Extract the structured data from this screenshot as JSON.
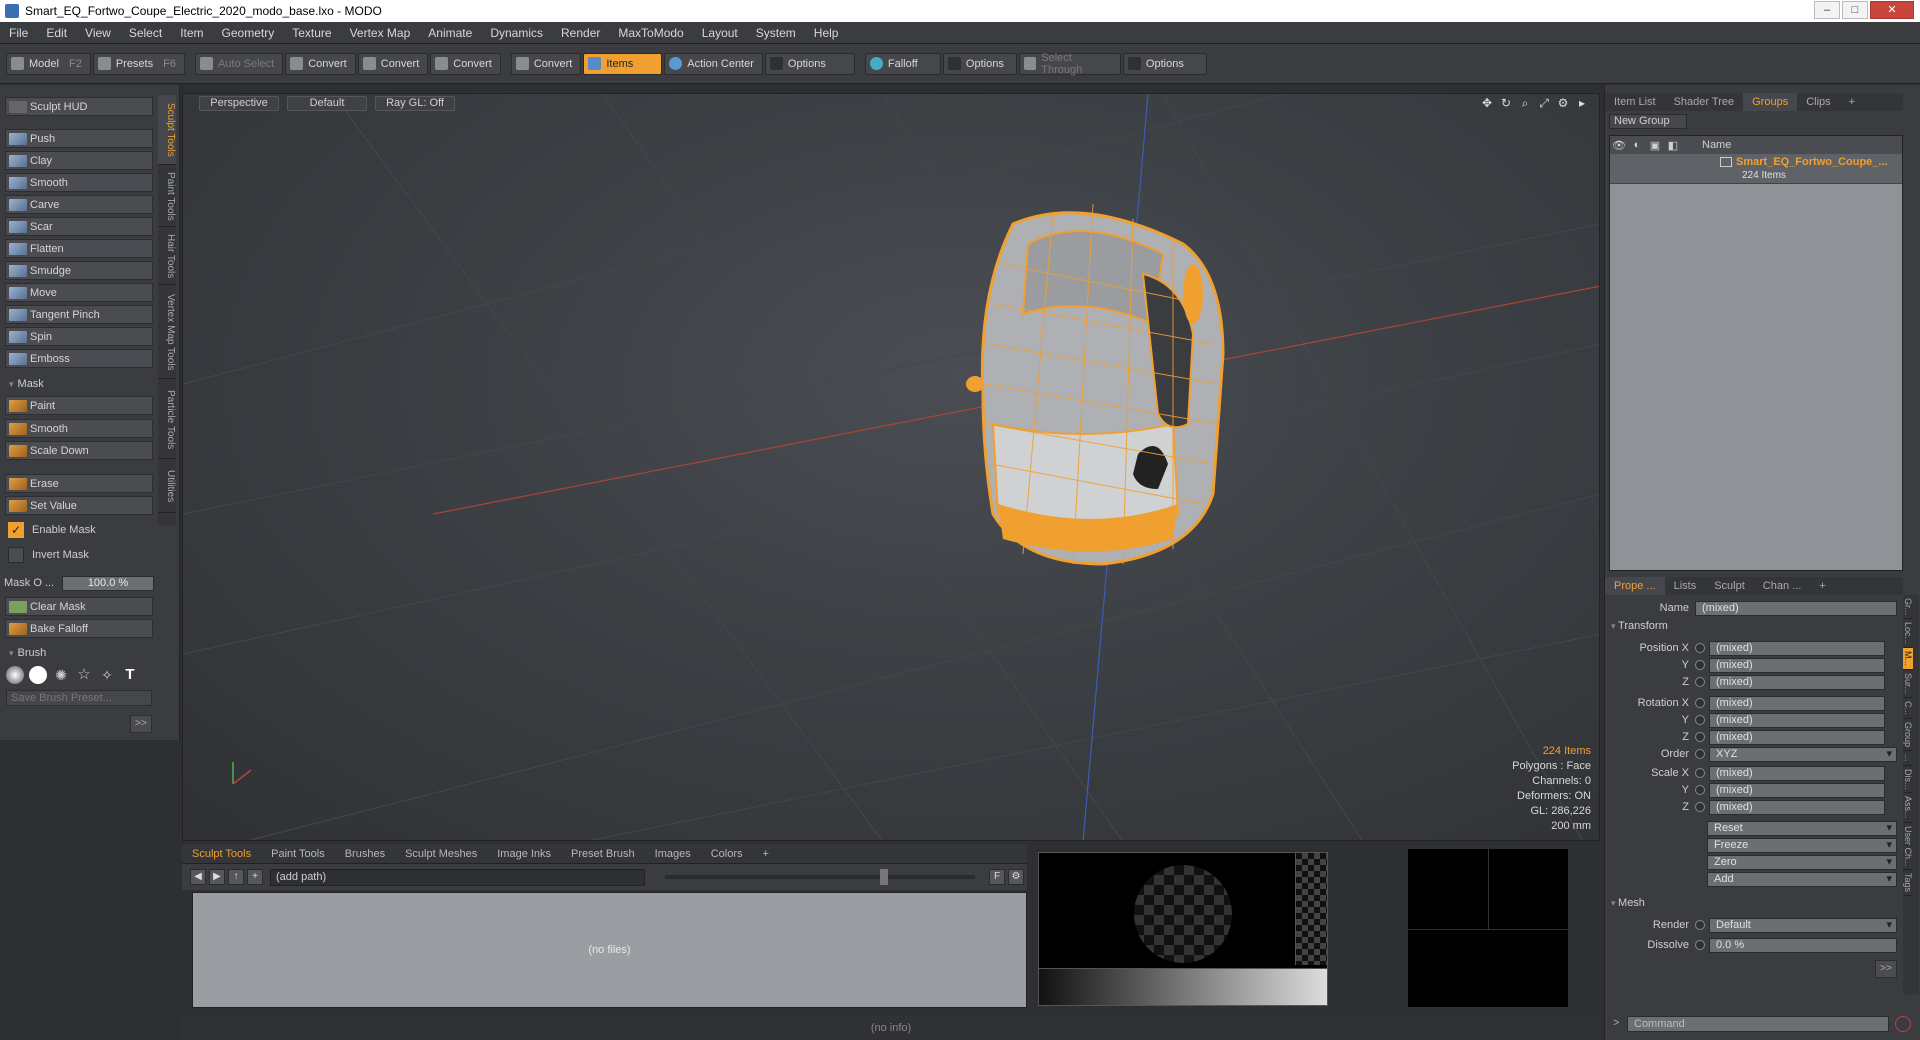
{
  "window": {
    "title": "Smart_EQ_Fortwo_Coupe_Electric_2020_modo_base.lxo - MODO"
  },
  "menu": [
    "File",
    "Edit",
    "View",
    "Select",
    "Item",
    "Geometry",
    "Texture",
    "Vertex Map",
    "Animate",
    "Dynamics",
    "Render",
    "MaxToModo",
    "Layout",
    "System",
    "Help"
  ],
  "toolbar": {
    "model": "Model",
    "model_key": "F2",
    "presets": "Presets",
    "presets_key": "F6",
    "auto_select": "Auto Select",
    "convert1": "Convert",
    "convert2": "Convert",
    "convert3": "Convert",
    "convert4": "Convert",
    "items": "Items",
    "action_center": "Action Center",
    "options1": "Options",
    "falloff": "Falloff",
    "options2": "Options",
    "select_through": "Select Through",
    "options3": "Options"
  },
  "sculpt": {
    "hud": "Sculpt HUD",
    "tools": [
      "Push",
      "Clay",
      "Smooth",
      "Carve",
      "Scar",
      "Flatten",
      "Smudge",
      "Move",
      "Tangent Pinch",
      "Spin",
      "Emboss"
    ],
    "mask_header": "Mask",
    "mask_tools": [
      "Paint",
      "Smooth",
      "Scale Down"
    ],
    "erase": "Erase",
    "set_value": "Set Value",
    "enable_mask": "Enable Mask",
    "invert_mask": "Invert Mask",
    "mask_opacity_label": "Mask O ...",
    "mask_opacity_value": "100.0 %",
    "clear_mask": "Clear Mask",
    "bake_falloff": "Bake Falloff",
    "brush_header": "Brush",
    "save_brush": "Save Brush Preset...",
    "more": ">>"
  },
  "vtabs": [
    "Sculpt Tools",
    "Paint Tools",
    "Hair Tools",
    "Vertex Map Tools",
    "Particle Tools",
    "Utilities"
  ],
  "viewport": {
    "view": "Perspective",
    "shading": "Default",
    "raygl": "Ray GL: Off",
    "info": {
      "items": "224 Items",
      "polygons": "Polygons : Face",
      "channels": "Channels: 0",
      "deformers": "Deformers: ON",
      "gl": "GL: 286,226",
      "scale": "200 mm"
    }
  },
  "lower": {
    "tabs": [
      "Sculpt Tools",
      "Paint Tools",
      "Brushes",
      "Sculpt Meshes",
      "Image Inks",
      "Preset Brush",
      "Images",
      "Colors",
      "+"
    ],
    "path": "(add path)",
    "files": "(no files)",
    "status": "(no info)"
  },
  "right": {
    "top_tabs": [
      "Item List",
      "Shader Tree",
      "Groups",
      "Clips",
      "+"
    ],
    "new_group": "New Group",
    "col_name": "Name",
    "group_name": "Smart_EQ_Fortwo_Coupe_...",
    "group_count": "224 Items",
    "prop_tabs": [
      "Prope ...",
      "Lists",
      "Sculpt",
      "Chan ...",
      "+"
    ],
    "name_label": "Name",
    "name_value": "(mixed)",
    "transform": "Transform",
    "position_x": "Position X",
    "rotation_x": "Rotation X",
    "scale_x": "Scale X",
    "y": "Y",
    "z": "Z",
    "mixed": "(mixed)",
    "order_label": "Order",
    "order_value": "XYZ",
    "reset": "Reset",
    "freeze": "Freeze",
    "zero": "Zero",
    "add": "Add",
    "mesh": "Mesh",
    "render_label": "Render",
    "render_value": "Default",
    "dissolve_label": "Dissolve",
    "dissolve_value": "0.0 %",
    "command": "Command",
    "side_tabs": [
      "Gr...",
      "Loc...",
      "M...",
      "Sur...",
      "C...",
      "Group",
      "...",
      "Dis...",
      "Ass...",
      "User Ch...",
      "Tags"
    ]
  },
  "colors": {
    "accent": "#f0a030",
    "axis_x": "#b03a30",
    "axis_z": "#3a5ab0"
  }
}
